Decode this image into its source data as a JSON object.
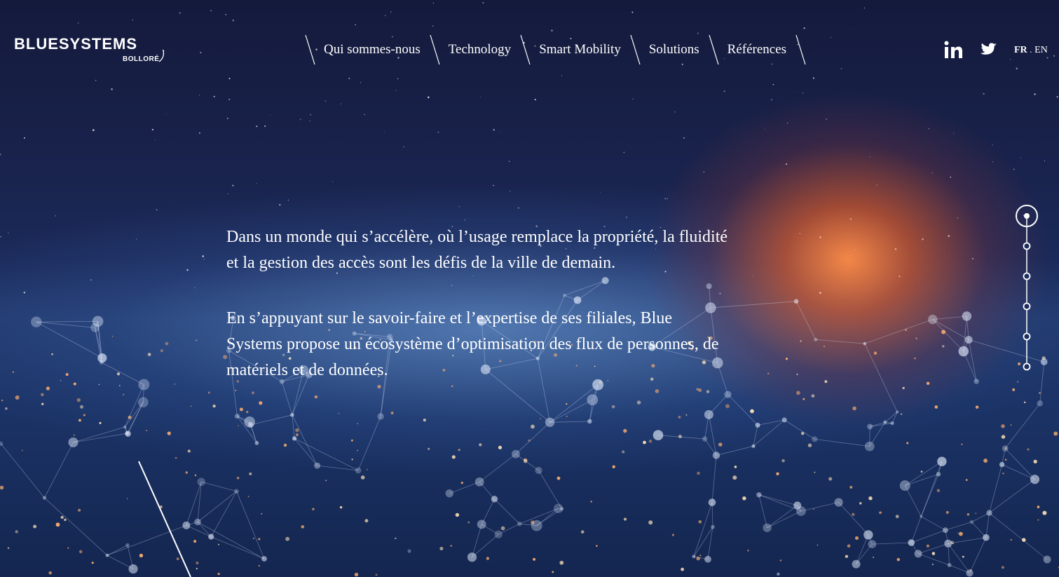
{
  "brand": {
    "name": "BLUESYSTEMS",
    "sub": "BOLLORÉ"
  },
  "nav": {
    "items": [
      {
        "label": "Qui sommes-nous"
      },
      {
        "label": "Technology"
      },
      {
        "label": "Smart Mobility"
      },
      {
        "label": "Solutions"
      },
      {
        "label": "Références"
      }
    ]
  },
  "social": {
    "icons": [
      "linkedin-icon",
      "twitter-icon"
    ]
  },
  "lang": {
    "fr": "FR",
    "sep": " . ",
    "en": "EN",
    "active": "FR"
  },
  "intro": {
    "p1": "Dans un monde qui s’accélère, où l’usage remplace la propriété, la fluidité et la gestion des accès sont les défis de la ville de demain.",
    "p2": "En s’appuyant sur le savoir-faire et l’expertise de ses filiales, Blue Systems propose un écosystème d’optimisation des flux de personnes, de matériels et de données."
  },
  "section_nav": {
    "count": 6,
    "active": 1
  },
  "colors": {
    "background": "#19234d",
    "glow": "#e0622a",
    "text": "#ffffff"
  }
}
